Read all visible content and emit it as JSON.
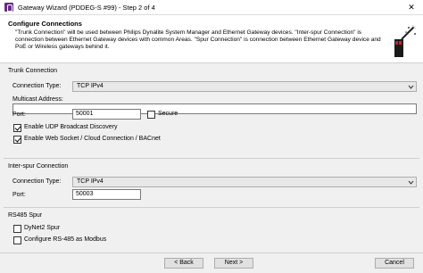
{
  "window": {
    "title": "Gateway Wizard (PDDEG-S #99) - Step 2 of 4",
    "close_glyph": "✕"
  },
  "header": {
    "title": "Configure Connections",
    "description": "\"Trunk Connection\" will be used between Philips Dynalite System Manager and Ethernet Gateway devices. \"Inter-spur Connection\" is connection between Ethernet Gateway devices with common Areas. \"Spur Connection\" is connection between Ethernet Gateway device and PoE or Wireless gateways behind it.",
    "icon": "wizard-wand-icon"
  },
  "trunk": {
    "section_label": "Trunk Connection",
    "connection_type_label": "Connection Type:",
    "connection_type_value": "TCP IPv4",
    "multicast_label": "Multicast Address:",
    "multicast_value": "",
    "port_label": "Port:",
    "port_value": "50001",
    "secure_label": "Secure",
    "secure_checked": false,
    "udp_label": "Enable UDP Broadcast Discovery",
    "udp_checked": true,
    "web_label": "Enable Web Socket / Cloud Connection / BACnet",
    "web_checked": true
  },
  "interspur": {
    "section_label": "Inter-spur Connection",
    "connection_type_label": "Connection Type:",
    "connection_type_value": "TCP IPv4",
    "port_label": "Port:",
    "port_value": "50003"
  },
  "rs485": {
    "section_label": "RS485 Spur",
    "dynet_label": "DyNet2 Spur",
    "dynet_checked": false,
    "modbus_label": "Configure RS-485 as Modbus",
    "modbus_checked": false
  },
  "footer": {
    "back_label": "< Back",
    "next_label": "Next >",
    "cancel_label": "Cancel"
  },
  "colors": {
    "title_icon": "#6a2a8a",
    "dialog_bg": "#f0f0f0",
    "header_bg": "#ffffff"
  }
}
